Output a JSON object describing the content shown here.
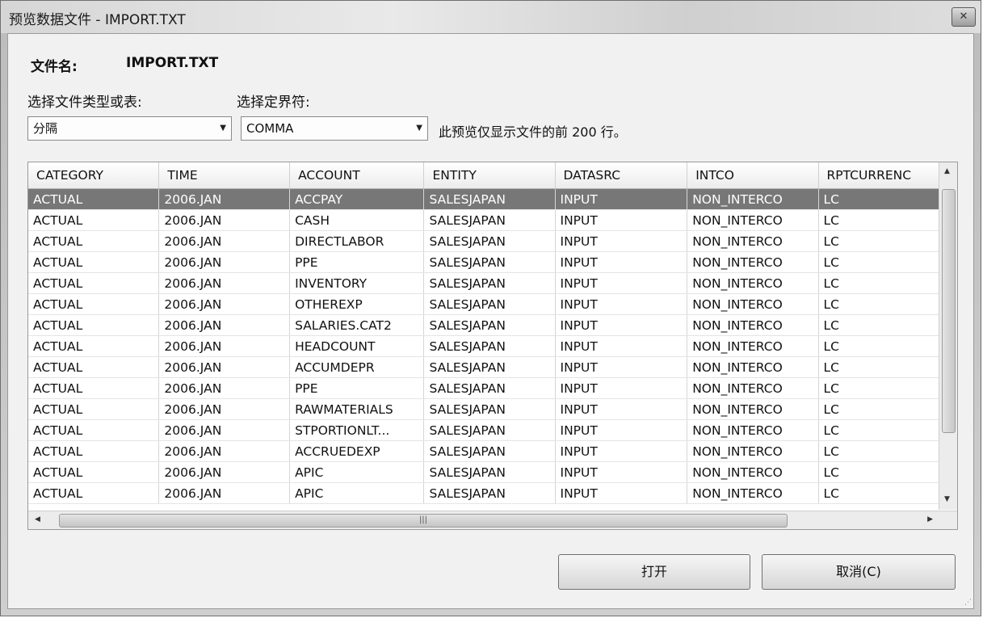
{
  "window": {
    "title": "预览数据文件 - IMPORT.TXT"
  },
  "file": {
    "label": "文件名:",
    "name": "IMPORT.TXT"
  },
  "file_type": {
    "label": "选择文件类型或表:",
    "value": "分隔"
  },
  "delimiter": {
    "label": "选择定界符:",
    "value": "COMMA"
  },
  "preview_note": "此预览仅显示文件的前 200 行。",
  "table": {
    "columns": [
      "CATEGORY",
      "TIME",
      "ACCOUNT",
      "ENTITY",
      "DATASRC",
      "INTCO",
      "RPTCURRENC"
    ],
    "rows": [
      [
        "ACTUAL",
        "2006.JAN",
        "ACCPAY",
        "SALESJAPAN",
        "INPUT",
        "NON_INTERCO",
        "LC"
      ],
      [
        "ACTUAL",
        "2006.JAN",
        "CASH",
        "SALESJAPAN",
        "INPUT",
        "NON_INTERCO",
        "LC"
      ],
      [
        "ACTUAL",
        "2006.JAN",
        "DIRECTLABOR",
        "SALESJAPAN",
        "INPUT",
        "NON_INTERCO",
        "LC"
      ],
      [
        "ACTUAL",
        "2006.JAN",
        "PPE",
        "SALESJAPAN",
        "INPUT",
        "NON_INTERCO",
        "LC"
      ],
      [
        "ACTUAL",
        "2006.JAN",
        "INVENTORY",
        "SALESJAPAN",
        "INPUT",
        "NON_INTERCO",
        "LC"
      ],
      [
        "ACTUAL",
        "2006.JAN",
        "OTHEREXP",
        "SALESJAPAN",
        "INPUT",
        "NON_INTERCO",
        "LC"
      ],
      [
        "ACTUAL",
        "2006.JAN",
        "SALARIES.CAT2",
        "SALESJAPAN",
        "INPUT",
        "NON_INTERCO",
        "LC"
      ],
      [
        "ACTUAL",
        "2006.JAN",
        "HEADCOUNT",
        "SALESJAPAN",
        "INPUT",
        "NON_INTERCO",
        "LC"
      ],
      [
        "ACTUAL",
        "2006.JAN",
        "ACCUMDEPR",
        "SALESJAPAN",
        "INPUT",
        "NON_INTERCO",
        "LC"
      ],
      [
        "ACTUAL",
        "2006.JAN",
        "PPE",
        "SALESJAPAN",
        "INPUT",
        "NON_INTERCO",
        "LC"
      ],
      [
        "ACTUAL",
        "2006.JAN",
        "RAWMATERIALS",
        "SALESJAPAN",
        "INPUT",
        "NON_INTERCO",
        "LC"
      ],
      [
        "ACTUAL",
        "2006.JAN",
        "STPORTIONLT...",
        "SALESJAPAN",
        "INPUT",
        "NON_INTERCO",
        "LC"
      ],
      [
        "ACTUAL",
        "2006.JAN",
        "ACCRUEDEXP",
        "SALESJAPAN",
        "INPUT",
        "NON_INTERCO",
        "LC"
      ],
      [
        "ACTUAL",
        "2006.JAN",
        "APIC",
        "SALESJAPAN",
        "INPUT",
        "NON_INTERCO",
        "LC"
      ],
      [
        "ACTUAL",
        "2006.JAN",
        "APIC",
        "SALESJAPAN",
        "INPUT",
        "NON_INTERCO",
        "LC"
      ]
    ],
    "selected_row": 0
  },
  "buttons": {
    "open": "打开",
    "cancel": "取消(C)"
  },
  "icons": {
    "close": "close-icon",
    "dropdown": "chevron-down-icon",
    "scroll_up": "triangle-up-icon",
    "scroll_down": "triangle-down-icon",
    "scroll_left": "triangle-left-icon",
    "scroll_right": "triangle-right-icon",
    "grip": "resize-grip-icon"
  },
  "colors": {
    "selected_row_bg": "#777777",
    "selected_row_text": "#ffffff"
  }
}
